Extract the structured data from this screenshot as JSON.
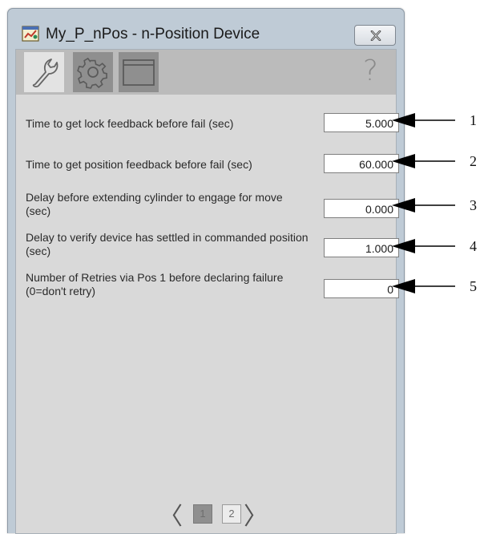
{
  "window": {
    "title": "My_P_nPos - n-Position Device"
  },
  "toolbar": {
    "tabs": [
      {
        "icon": "wrench-icon",
        "name": "Maintenance",
        "active": true
      },
      {
        "icon": "gear-icon",
        "name": "Configuration",
        "active": false
      },
      {
        "icon": "display-icon",
        "name": "Display",
        "active": false
      }
    ],
    "help_label": "?"
  },
  "parameters": [
    {
      "label": "Time to get lock feedback before fail (sec)",
      "value": "5.000"
    },
    {
      "label": "Time to get position feedback before fail (sec)",
      "value": "60.000"
    },
    {
      "label": "Delay before extending cylinder to engage for move (sec)",
      "value": "0.000"
    },
    {
      "label": "Delay to verify device has settled in commanded position (sec)",
      "value": "1.000"
    },
    {
      "label": "Number of Retries via Pos 1 before declaring failure (0=don't retry)",
      "value": "0"
    }
  ],
  "pager": {
    "prev": "〈",
    "next": "〉",
    "pages": [
      "1",
      "2"
    ],
    "current": "1"
  },
  "callouts": [
    "1",
    "2",
    "3",
    "4",
    "5"
  ],
  "colors": {
    "window_frame": "#bfcbd6",
    "client_bg": "#d9d9d9",
    "toolbar_bg": "#bbbbbb",
    "active_tab": "#e3e3e3",
    "inactive_tab": "#8f8f8f"
  }
}
